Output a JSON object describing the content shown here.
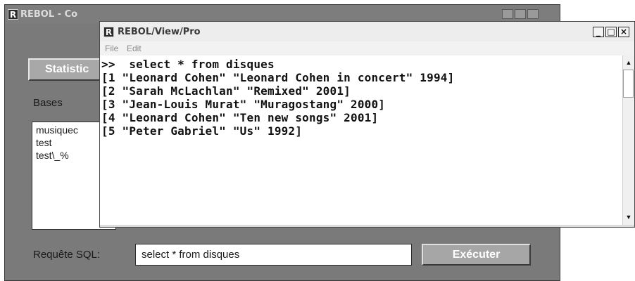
{
  "back_window": {
    "title": "REBOL - Co",
    "statistics_button": "Statistic",
    "bases_label": "Bases",
    "bases_items": [
      "musiquec",
      "test",
      "test\\_%"
    ],
    "sql_label": "Requête SQL:",
    "sql_input_value": "select * from disques",
    "execute_button": "Exécuter"
  },
  "front_window": {
    "title": "REBOL/View/Pro",
    "menu": [
      "File",
      "Edit"
    ],
    "console_lines": [
      ">>  select * from disques",
      "[1 \"Leonard Cohen\" \"Leonard Cohen in concert\" 1994]",
      "[2 \"Sarah McLachlan\" \"Remixed\" 2001]",
      "[3 \"Jean-Louis Murat\" \"Muragostang\" 2000]",
      "[4 \"Leonard Cohen\" \"Ten new songs\" 2001]",
      "[5 \"Peter Gabriel\" \"Us\" 1992]"
    ],
    "controls": {
      "minimize": "_",
      "maximize": "□",
      "close": "×"
    }
  },
  "icons": {
    "app_logo": "R",
    "scroll_up": "▲",
    "scroll_down": "▼"
  }
}
